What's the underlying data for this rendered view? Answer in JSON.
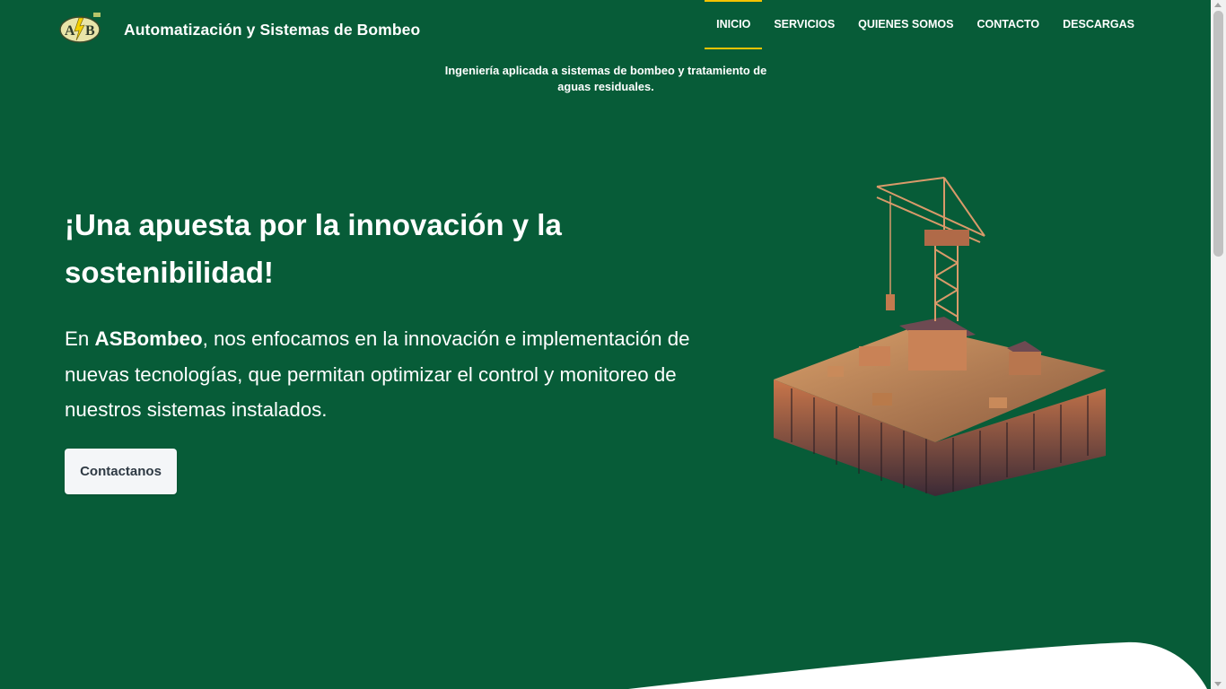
{
  "header": {
    "logo_text": "ASB",
    "brand_name": "Automatización y Sistemas de Bombeo",
    "tagline": "Ingeniería aplicada a sistemas de bombeo y tratamiento de aguas residuales."
  },
  "nav": {
    "items": [
      {
        "label": "INICIO",
        "active": true
      },
      {
        "label": "SERVICIOS"
      },
      {
        "label": "QUIENES SOMOS"
      },
      {
        "label": "CONTACTO"
      },
      {
        "label": "DESCARGAS"
      }
    ]
  },
  "hero": {
    "title": "¡Una apuesta por la innovación y la sostenibilidad!",
    "text_prefix": "En ",
    "text_brand": "ASBombeo",
    "text_suffix": ", nos enfocamos en la innovación e implementación de nuevas tecnologías, que permitan optimizar el control y monitoreo de nuestros sistemas instalados.",
    "cta_label": "Contactanos",
    "illustration_icon": "crane-platform-illustration"
  },
  "colors": {
    "background": "#075c38",
    "accent": "#f5c300",
    "button_bg": "#f4f6f8",
    "button_text": "#2f3a44"
  }
}
